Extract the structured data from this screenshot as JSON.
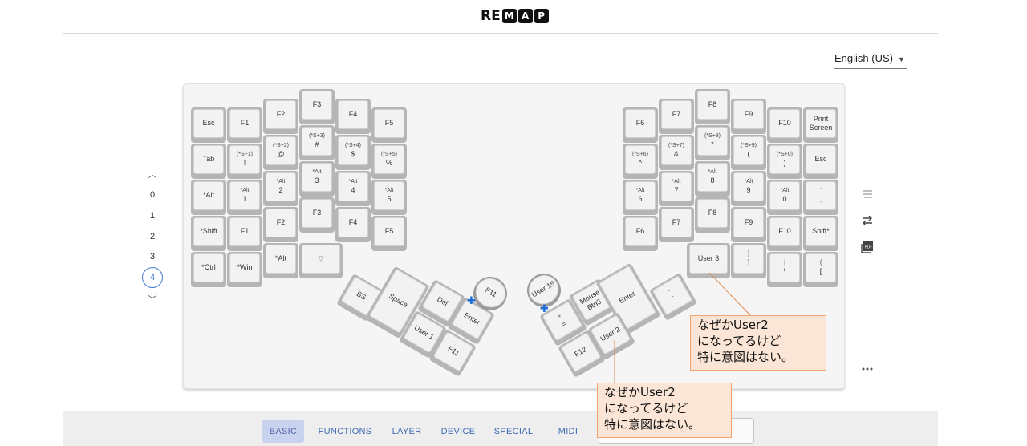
{
  "logo": {
    "prefix": "RE",
    "boxed": [
      "M",
      "A",
      "P"
    ]
  },
  "language": {
    "label": "English (US)"
  },
  "layers": {
    "items": [
      "0",
      "1",
      "2",
      "3",
      "4"
    ],
    "active": "4"
  },
  "tabs": [
    {
      "label": "BASIC",
      "active": true
    },
    {
      "label": "FUNCTIONS"
    },
    {
      "label": "LAYER"
    },
    {
      "label": "DEVICE"
    },
    {
      "label": "SPECIAL"
    },
    {
      "label": "MIDI"
    }
  ],
  "notes": {
    "note1": "なぜかUser2\nになってるけど\n特に意図はない。",
    "note2": "なぜかUser2\nになってるけど\n特に意図はない。"
  },
  "keys": {
    "l_esc": {
      "main": "Esc"
    },
    "l_f1": {
      "main": "F1"
    },
    "l_f2": {
      "main": "F2"
    },
    "l_f3": {
      "main": "F3"
    },
    "l_f4": {
      "main": "F4"
    },
    "l_f5": {
      "main": "F5"
    },
    "l_tab": {
      "main": "Tab"
    },
    "l_excl": {
      "sub": "(*S+1)",
      "main": "!"
    },
    "l_at": {
      "sub": "(*S+2)",
      "main": "@"
    },
    "l_hash": {
      "sub": "(*S+3)",
      "main": "#"
    },
    "l_dollar": {
      "sub": "(*S+4)",
      "main": "$"
    },
    "l_pct": {
      "sub": "(*S+5)",
      "main": "%"
    },
    "l_alt": {
      "main": "*Alt"
    },
    "l_a1": {
      "sub": "*Alt",
      "main": "1"
    },
    "l_a2": {
      "sub": "*Alt",
      "main": "2"
    },
    "l_a3": {
      "sub": "*Alt",
      "main": "3"
    },
    "l_a4": {
      "sub": "*Alt",
      "main": "4"
    },
    "l_a5": {
      "sub": "*Alt",
      "main": "5"
    },
    "l_shift": {
      "main": "*Shift"
    },
    "l_f1b": {
      "main": "F1"
    },
    "l_f2b": {
      "main": "F2"
    },
    "l_f3b": {
      "main": "F3"
    },
    "l_f4b": {
      "main": "F4"
    },
    "l_f5b": {
      "main": "F5"
    },
    "l_ctrl": {
      "main": "*Ctrl"
    },
    "l_win": {
      "main": "*Win"
    },
    "l_alt2": {
      "main": "*Alt"
    },
    "l_tri": {
      "main": "▽"
    },
    "l_bs": {
      "main": "BS"
    },
    "l_space": {
      "main": "Space"
    },
    "l_del": {
      "main": "Del"
    },
    "l_user1": {
      "main": "User 1"
    },
    "l_enter": {
      "main": "Enter"
    },
    "l_f11": {
      "main": "F11"
    },
    "l_f11r": {
      "main": "F11"
    },
    "r_f6": {
      "main": "F6"
    },
    "r_f7": {
      "main": "F7"
    },
    "r_f8": {
      "main": "F8"
    },
    "r_f9": {
      "main": "F9"
    },
    "r_f10": {
      "main": "F10"
    },
    "r_prt": {
      "main": "Print\nScreen"
    },
    "r_caret": {
      "sub": "(*S+6)",
      "main": "^"
    },
    "r_amp": {
      "sub": "(*S+7)",
      "main": "&"
    },
    "r_star": {
      "sub": "(*S+8)",
      "main": "*"
    },
    "r_lp": {
      "sub": "(*S+9)",
      "main": "("
    },
    "r_rp": {
      "sub": "(*S+0)",
      "main": ")"
    },
    "r_esc": {
      "main": "Esc"
    },
    "r_a6": {
      "sub": "*Alt",
      "main": "6"
    },
    "r_a7": {
      "sub": "*Alt",
      "main": "7"
    },
    "r_a8": {
      "sub": "*Alt",
      "main": "8"
    },
    "r_a9": {
      "sub": "*Alt",
      "main": "9"
    },
    "r_a0": {
      "sub": "*Alt",
      "main": "0"
    },
    "r_comma": {
      "sub": "'",
      "main": ","
    },
    "r_f6b": {
      "main": "F6"
    },
    "r_f7b": {
      "main": "F7"
    },
    "r_f8b": {
      "main": "F8"
    },
    "r_f9b": {
      "main": "F9"
    },
    "r_f10b": {
      "main": "F10"
    },
    "r_shift": {
      "main": "Shift*"
    },
    "r_user3": {
      "main": "User 3"
    },
    "r_brace": {
      "sub": "}",
      "main": "]"
    },
    "r_pipe": {
      "sub": "|",
      "main": "\\"
    },
    "r_lbrace": {
      "sub": "{",
      "main": "["
    },
    "r_user15": {
      "main": "User 15"
    },
    "r_plus": {
      "sub": "+",
      "main": "="
    },
    "r_mouse": {
      "main": "Mouse\nBtn3"
    },
    "r_enter": {
      "main": "Enter"
    },
    "r_tilde": {
      "sub": "~",
      "main": "`"
    },
    "r_f12": {
      "main": "F12"
    },
    "r_user2": {
      "main": "User 2"
    }
  }
}
